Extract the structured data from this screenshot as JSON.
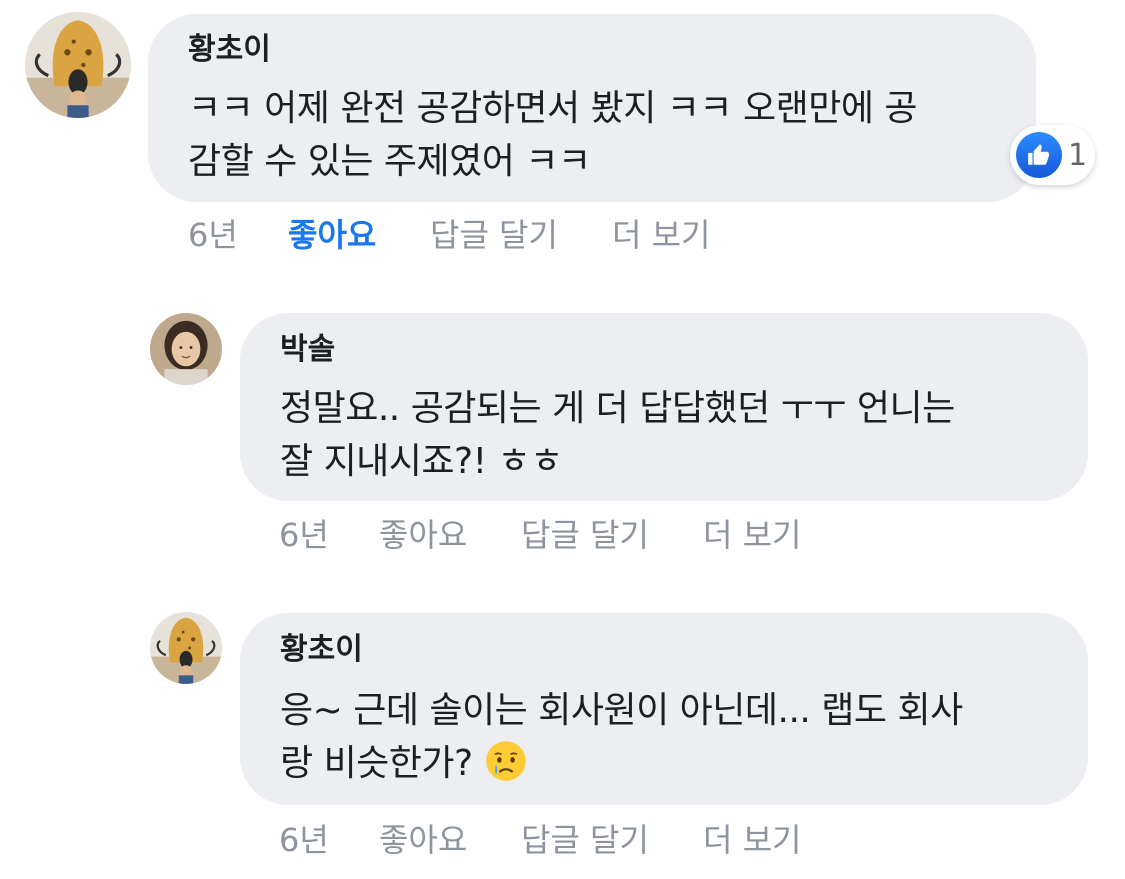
{
  "comments": [
    {
      "author": "황초이",
      "lines": [
        "ㅋㅋ 어제 완전 공감하면서 봤지 ㅋㅋ 오랜만에 공",
        "감할 수 있는 주제였어 ㅋㅋ"
      ],
      "time": "6년",
      "like_label": "좋아요",
      "reply_label": "답글 달기",
      "more_label": "더 보기",
      "liked": true,
      "reaction": {
        "icon": "thumbs-up-icon",
        "count": "1"
      }
    },
    {
      "author": "박솔",
      "lines": [
        "정말요.. 공감되는 게 더 답답했던 ㅜㅜ 언니는",
        "잘 지내시죠?! ㅎㅎ"
      ],
      "time": "6년",
      "like_label": "좋아요",
      "reply_label": "답글 달기",
      "more_label": "더 보기",
      "liked": false
    },
    {
      "author": "황초이",
      "lines": [
        "응~ 근데 솔이는 회사원이 아닌데... 랩도 회사",
        "랑 비슷한가?"
      ],
      "emoji": "crying-face-icon",
      "time": "6년",
      "like_label": "좋아요",
      "reply_label": "답글 달기",
      "more_label": "더 보기",
      "liked": false
    }
  ],
  "colors": {
    "bubble": "#eceef2",
    "meta": "#8d949e",
    "liked": "#1877f2",
    "text": "#1c1e21"
  }
}
